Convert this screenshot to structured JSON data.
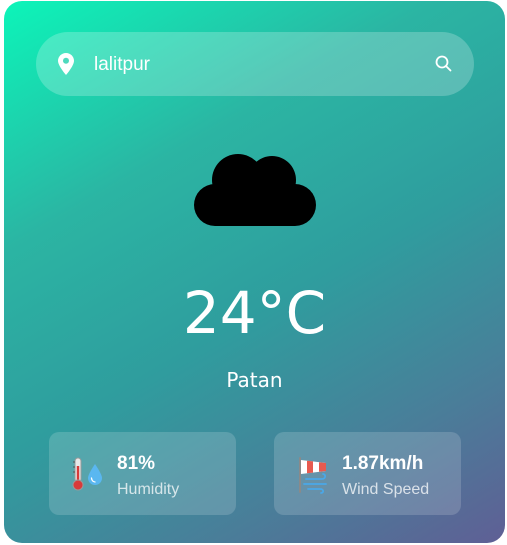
{
  "search": {
    "value": "lalitpur",
    "location_icon": "map-pin-icon",
    "search_icon": "search-icon"
  },
  "weather": {
    "icon": "cloud-icon",
    "temperature": "24°C",
    "city": "Patan"
  },
  "stats": {
    "humidity": {
      "icon": "thermometer-humidity-icon",
      "value": "81%",
      "label": "Humidity"
    },
    "wind": {
      "icon": "windsock-icon",
      "value": "1.87km/h",
      "label": "Wind Speed"
    }
  },
  "colors": {
    "gradient_start": "#0cf5b9",
    "gradient_end": "#5f5f95",
    "text": "#ffffff"
  }
}
